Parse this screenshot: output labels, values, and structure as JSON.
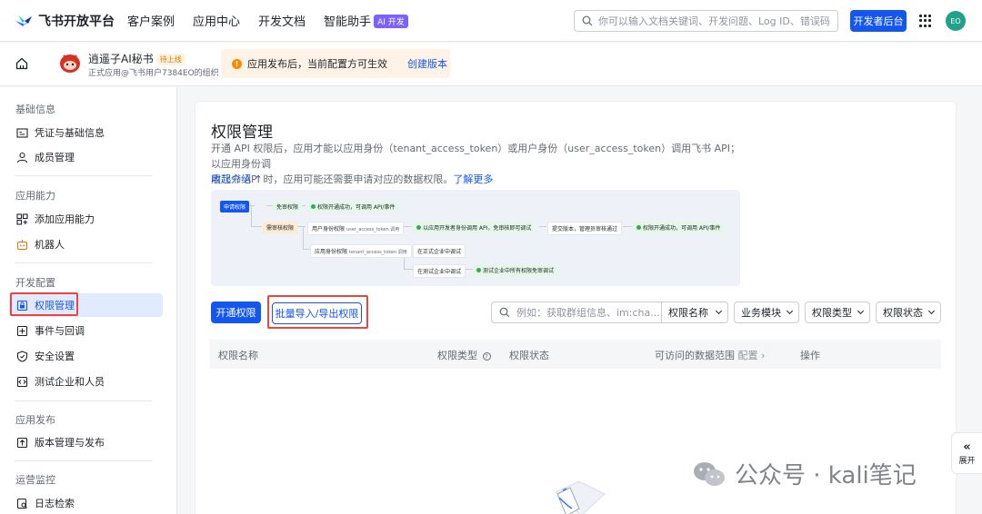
{
  "topnav": {
    "logo": "飞书开放平台",
    "items": [
      "客户案例",
      "应用中心",
      "开发文档",
      "智能助手"
    ],
    "ai_badge": "AI 开发",
    "search_placeholder": "你可以输入文档关键词、开发问题、Log ID、错误码",
    "dev_button": "开发者后台",
    "avatar": "EO"
  },
  "appbar": {
    "app_name": "逍遥子AI秘书",
    "app_status": "待上线",
    "app_sub": "正式应用@飞书用户7384EO的组织",
    "notice_text": "应用发布后，当前配置方可生效",
    "notice_link": "创建版本"
  },
  "sidebar": {
    "groups": [
      {
        "title": "基础信息",
        "items": [
          "凭证与基础信息",
          "成员管理"
        ]
      },
      {
        "title": "应用能力",
        "items": [
          "添加应用能力",
          "机器人"
        ]
      },
      {
        "title": "开发配置",
        "items": [
          "权限管理",
          "事件与回调",
          "安全设置",
          "测试企业和人员"
        ]
      },
      {
        "title": "应用发布",
        "items": [
          "版本管理与发布"
        ]
      },
      {
        "title": "运营监控",
        "items": [
          "日志检索"
        ]
      }
    ]
  },
  "main": {
    "title": "权限管理",
    "desc_line1": "开通 API 权限后，应用才能以应用身份（tenant_access_token）或用户身份（user_access_token）调用飞书 API；以应用身份调",
    "desc_line2": "用飞书 API 时，应用可能还需要申请对应的数据权限。",
    "learn_more": "了解更多",
    "collapse": "收起介绍",
    "flow": {
      "apply": "申请权限",
      "free": "免审权限",
      "free_result": "权限开通成功，可调用 API/事件",
      "review": "需审核权限",
      "user_perm": "用户身份权限",
      "user_token": "user_access_token 调用",
      "dev_call": "以应用开发者身份调用 API，免审核即可调试",
      "submit": "提交版本，管理员审核通过",
      "final_result": "权限开通成功，可调用 API/事件",
      "app_perm": "应用身份权限",
      "tenant_token": "tenant_access_token 调用",
      "formal": "在正式企业中调试",
      "test": "在测试企业中调试",
      "test_result": "测试企业中所有权限免审调试"
    },
    "btn_open": "开通权限",
    "btn_batch": "批量导入/导出权限",
    "filter_placeholder": "例如：获取群组信息、im:cha...",
    "filters": [
      "权限名称",
      "业务模块",
      "权限类型",
      "权限状态"
    ],
    "columns": [
      "权限名称",
      "权限类型",
      "权限状态",
      "可访问的数据范围",
      "配置",
      "操作"
    ]
  },
  "expand_tab": "展开",
  "watermark": "公众号 · kali笔记"
}
